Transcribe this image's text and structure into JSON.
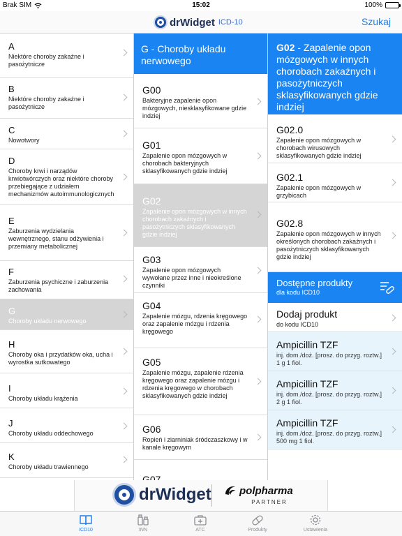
{
  "status_bar": {
    "carrier": "Brak SIM",
    "time": "15:02",
    "battery": "100%"
  },
  "navbar": {
    "logo_text": "drWidget",
    "logo_sub": "ICD-10",
    "search_label": "Szukaj"
  },
  "chapters": [
    {
      "code": "A",
      "desc": "Niektóre choroby zakaźne i pasożytnicze"
    },
    {
      "code": "B",
      "desc": "Niektóre choroby zakaźne i pasożytnicze"
    },
    {
      "code": "C",
      "desc": "Nowotwory"
    },
    {
      "code": "D",
      "desc": "Choroby krwi i narządów krwiotwórczych oraz niektóre choroby przebiegające z udziałem mechanizmów autoimmunologicznych"
    },
    {
      "code": "E",
      "desc": "Zaburzenia wydzielania wewnętrznego, stanu odżywienia i przemiany metabolicznej"
    },
    {
      "code": "F",
      "desc": "Zaburzenia psychiczne i zaburzenia zachowania"
    },
    {
      "code": "G",
      "desc": "Choroby układu nerwowego"
    },
    {
      "code": "H",
      "desc": "Choroby oka i przydatków oka, ucha i wyrostka sutkowatego"
    },
    {
      "code": "I",
      "desc": "Choroby układu krążenia"
    },
    {
      "code": "J",
      "desc": "Choroby układu oddechowego"
    },
    {
      "code": "K",
      "desc": "Choroby układu trawiennego"
    }
  ],
  "column2": {
    "header": "G - Choroby układu nerwowego",
    "items": [
      {
        "code": "G00",
        "desc": "Bakteryjne zapalenie opon mózgowych, niesklasyfikowane gdzie indziej"
      },
      {
        "code": "G01",
        "desc": "Zapalenie opon mózgowych w chorobach bakteryjnych sklasyfikowanych gdzie indziej"
      },
      {
        "code": "G02",
        "desc": "Zapalenie opon mózgowych w innych chorobach zakaźnych i pasożytniczych sklasyfikowanych gdzie indziej"
      },
      {
        "code": "G03",
        "desc": "Zapalenie opon mózgowych wywołane przez inne i nieokreślone czynniki"
      },
      {
        "code": "G04",
        "desc": "Zapalenie mózgu, rdzenia kręgowego oraz zapalenie mózgu i rdzenia kręgowego"
      },
      {
        "code": "G05",
        "desc": "Zapalenie mózgu, zapalenie rdzenia kręgowego oraz zapalenie mózgu i rdzenia kręgowego w chorobach sklasyfikowanych gdzie indziej"
      },
      {
        "code": "G06",
        "desc": "Ropień i ziarniniak śródczaszkowy i w kanale kręgowym"
      },
      {
        "code": "G07",
        "desc": ""
      }
    ]
  },
  "column3": {
    "header_code": "G02",
    "header_desc": " - Zapalenie opon mózgowych w innych chorobach zakaźnych i pasożytniczych sklasyfikowanych gdzie indziej",
    "items": [
      {
        "code": "G02.0",
        "desc": "Zapalenie opon mózgowych w chorobach wirusowych sklasyfikowanych gdzie indziej"
      },
      {
        "code": "G02.1",
        "desc": "Zapalenie opon mózgowych w grzybicach"
      },
      {
        "code": "G02.8",
        "desc": "Zapalenie opon mózgowych w innych określonych chorobach zakaźnych i pasożytniczych sklasyfikowanych gdzie indziej"
      }
    ],
    "products_title": "Dostępne produkty",
    "products_subtitle": "dla kodu ICD10",
    "add_product_title": "Dodaj produkt",
    "add_product_subtitle": "do kodu ICD10",
    "products": [
      {
        "name": "Ampicillin TZF",
        "details": "inj. dom./doż. [prosz. do przyg. roztw.] 1 g 1 fiol."
      },
      {
        "name": "Ampicillin TZF",
        "details": "inj. dom./doż. [prosz. do przyg. roztw.] 2 g 1 fiol."
      },
      {
        "name": "Ampicillin TZF",
        "details": "inj. dom./doż. [prosz. do przyg. roztw.] 500 mg 1 fiol."
      }
    ]
  },
  "banner": {
    "left_text": "drWidget",
    "right_text": "polpharma",
    "right_sub": "PARTNER"
  },
  "tabs": [
    {
      "label": "ICD10",
      "icon": "book-icon",
      "active": true
    },
    {
      "label": "INN",
      "icon": "bottles-icon",
      "active": false
    },
    {
      "label": "ATC",
      "icon": "medkit-icon",
      "active": false
    },
    {
      "label": "Produkty",
      "icon": "pill-icon",
      "active": false
    },
    {
      "label": "Ustawienia",
      "icon": "gear-icon",
      "active": false
    }
  ],
  "colors": {
    "accent": "#1a84f2",
    "selected": "#d5d5d5",
    "product_bg": "#e7f4fc",
    "tab_active": "#1a7ef0"
  }
}
